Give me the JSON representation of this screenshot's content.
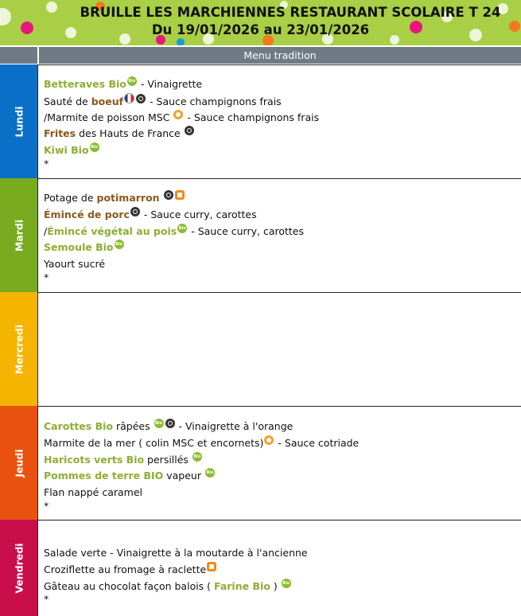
{
  "header": {
    "title": "BRUILLE LES MARCHIENNES RESTAURANT SCOLAIRE T 24",
    "date_range": "Du 19/01/2026 au 23/01/2026",
    "background_color": "#a8cf45"
  },
  "menu_column_label": "Menu tradition",
  "days": [
    {
      "name": "Lundi",
      "color": "#0a6fc6",
      "lines": [
        [
          {
            "t": "Betteraves Bio",
            "s": "hl"
          },
          {
            "icon": "bio"
          },
          {
            "t": " - Vinaigrette"
          }
        ],
        [
          {
            "t": "Sauté de "
          },
          {
            "t": "boeuf",
            "s": "br"
          },
          {
            "icon": "french-flag"
          },
          {
            "icon": "local"
          },
          {
            "t": " - Sauce champignons frais"
          }
        ],
        [
          {
            "t": "/Marmite de poisson MSC "
          },
          {
            "icon": "msc"
          },
          {
            "t": " - Sauce champignons frais"
          }
        ],
        [
          {
            "t": "Frites",
            "s": "br"
          },
          {
            "t": " des Hauts de France "
          },
          {
            "icon": "local"
          }
        ],
        [
          {
            "t": "Kiwi Bio",
            "s": "hl"
          },
          {
            "icon": "bio"
          }
        ],
        [
          {
            "t": "*"
          }
        ]
      ]
    },
    {
      "name": "Mardi",
      "color": "#78ab1f",
      "lines": [
        [
          {
            "t": "Potage de "
          },
          {
            "t": "potimarron",
            "s": "br"
          },
          {
            "t": "  "
          },
          {
            "icon": "local"
          },
          {
            "icon": "homemade"
          }
        ],
        [
          {
            "t": "Émincé de porc",
            "s": "br"
          },
          {
            "icon": "local"
          },
          {
            "t": " - Sauce curry, carottes"
          }
        ],
        [
          {
            "t": "/"
          },
          {
            "t": "Émincé végétal au pois",
            "s": "hl"
          },
          {
            "icon": "bio"
          },
          {
            "t": " - Sauce curry, carottes"
          }
        ],
        [
          {
            "t": "Semoule Bio",
            "s": "hl"
          },
          {
            "icon": "bio"
          }
        ],
        [
          {
            "t": "Yaourt sucré"
          }
        ],
        [
          {
            "t": "*"
          }
        ]
      ]
    },
    {
      "name": "Mercredi",
      "color": "#f5b400",
      "lines": []
    },
    {
      "name": "Jeudi",
      "color": "#e8520e",
      "lines": [
        [
          {
            "t": "Carottes Bio",
            "s": "hl"
          },
          {
            "t": " râpées "
          },
          {
            "icon": "bio"
          },
          {
            "icon": "local"
          },
          {
            "t": " - Vinaigrette à l'orange"
          }
        ],
        [
          {
            "t": "Marmite de la mer ( colin MSC et encornets)"
          },
          {
            "icon": "msc"
          },
          {
            "t": " - Sauce cotriade"
          }
        ],
        [
          {
            "t": "Haricots verts Bio",
            "s": "hl"
          },
          {
            "t": " persillés "
          },
          {
            "icon": "bio"
          }
        ],
        [
          {
            "t": "Pommes de terre BIO",
            "s": "hl"
          },
          {
            "t": " vapeur  "
          },
          {
            "icon": "bio"
          }
        ],
        [
          {
            "t": "Flan nappé caramel"
          }
        ],
        [
          {
            "t": "*"
          }
        ]
      ]
    },
    {
      "name": "Vendredi",
      "color": "#c90e4c",
      "lines": [
        [
          {
            "t": "Salade verte - Vinaigrette à la moutarde à l'ancienne"
          }
        ],
        [
          {
            "t": "Croziflette au fromage à raclette"
          },
          {
            "icon": "homemade"
          }
        ],
        [
          {
            "t": "Gâteau au chocolat façon balois ( "
          },
          {
            "t": "Farine Bio",
            "s": "hl"
          },
          {
            "t": " ) "
          },
          {
            "icon": "bio"
          }
        ],
        [
          {
            "t": "*"
          }
        ]
      ]
    }
  ]
}
